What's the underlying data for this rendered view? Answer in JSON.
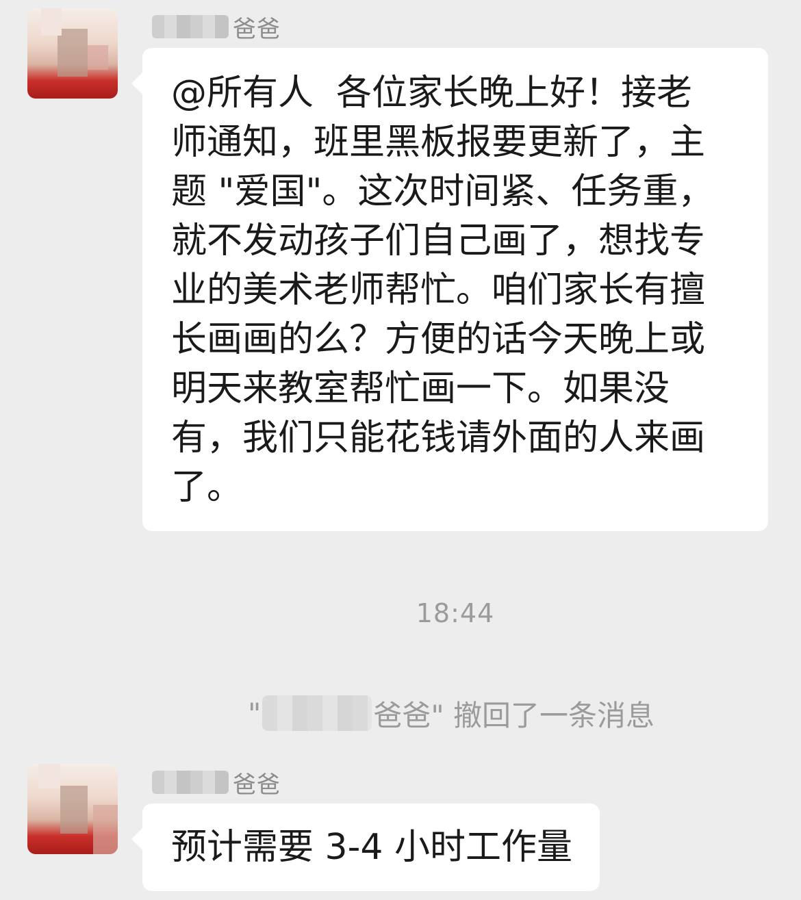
{
  "chat": {
    "messages": [
      {
        "sender_suffix": "爸爸",
        "text": "@所有人 各位家长晚上好！接老师通知，班里黑板报要更新了，主题 \"爱国\"。这次时间紧、任务重，就不发动孩子们自己画了，想找专业的美术老师帮忙。咱们家长有擅长画画的么？方便的话今天晚上或明天来教室帮忙画一下。如果没有，我们只能花钱请外面的人来画了。",
        "lines": [
          "@所有人  各位家长晚上好！接老",
          "师通知，班里黑板报要更新了，主",
          "题 \"爱国\"。这次时间紧、任务重，",
          "就不发动孩子们自己画了，想找专",
          "业的美术老师帮忙。咱们家长有擅",
          "长画画的么？方便的话今天晚上或",
          "明天来教室帮忙画一下。如果没",
          "有，我们只能花钱请外面的人来画",
          "了。"
        ]
      },
      {
        "sender_suffix": "爸爸",
        "text": "预计需要 3-4 小时工作量"
      }
    ],
    "timestamp": "18:44",
    "recall_notice": {
      "open_quote": "\"",
      "suffix": "爸爸\" 撤回了一条消息"
    }
  }
}
